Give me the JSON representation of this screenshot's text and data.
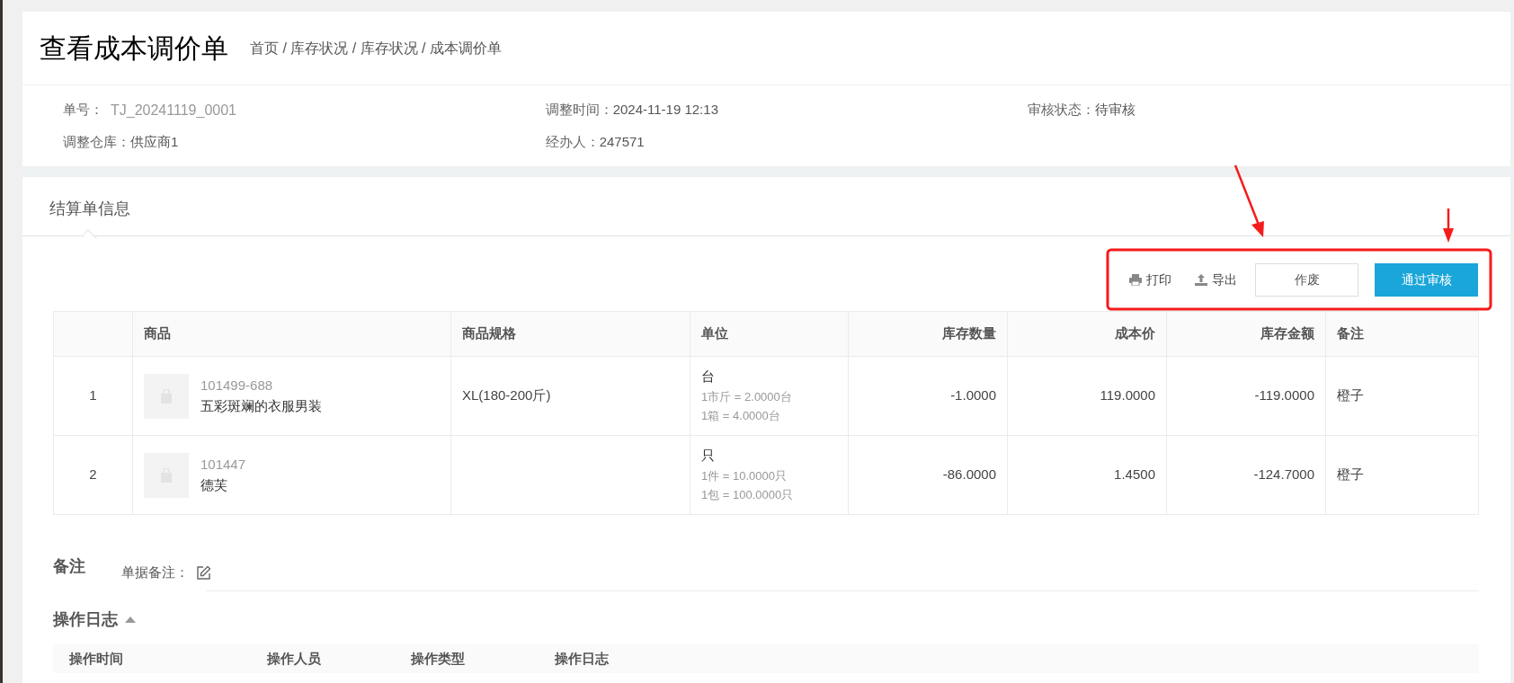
{
  "page": {
    "title": "查看成本调价单",
    "breadcrumb": "首页 / 库存状况 / 库存状况 / 成本调价单"
  },
  "info": [
    {
      "label": "单号：",
      "value": "TJ_20241119_0001",
      "kind": "code"
    },
    {
      "label": "调整时间：",
      "value": "2024-11-19 12:13",
      "kind": "plain"
    },
    {
      "label": "审核状态：",
      "value": "待审核",
      "kind": "plain"
    },
    {
      "label": "调整仓库：",
      "value": "供应商1",
      "kind": "plain"
    },
    {
      "label": "经办人：",
      "value": "247571",
      "kind": "plain"
    }
  ],
  "tabs": [
    {
      "label": "结算单信息",
      "selected": true
    }
  ],
  "toolbar": {
    "links": [
      {
        "label": "打印",
        "kind": "print"
      },
      {
        "label": "导出",
        "kind": "export"
      }
    ],
    "buttons": [
      {
        "label": "作废",
        "kind": "default"
      },
      {
        "label": "通过审核",
        "kind": "primary"
      }
    ]
  },
  "table": {
    "columns": [
      "商品",
      "商品规格",
      "单位",
      "库存数量",
      "成本价",
      "库存金额",
      "备注"
    ],
    "rows": [
      {
        "index": "1",
        "code": "101499-688",
        "name": "五彩斑斓的衣服男装",
        "spec": "XL(180-200斤)",
        "unit": "台",
        "conversions": [
          "1市斤 = 2.0000台",
          "1箱 = 4.0000台"
        ],
        "qty": "-1.0000",
        "cost": "119.0000",
        "amount": "-119.0000",
        "remark": "橙子"
      },
      {
        "index": "2",
        "code": "101447",
        "name": "德芙",
        "spec": "",
        "unit": "只",
        "conversions": [
          "1件 = 10.0000只",
          "1包 = 100.0000只"
        ],
        "qty": "-86.0000",
        "cost": "1.4500",
        "amount": "-124.7000",
        "remark": "橙子"
      }
    ]
  },
  "remarks": {
    "heading": "备注",
    "label": "单据备注："
  },
  "log": {
    "heading": "操作日志",
    "expanded": true,
    "columns": [
      "操作时间",
      "操作人员",
      "操作类型",
      "操作日志"
    ]
  }
}
